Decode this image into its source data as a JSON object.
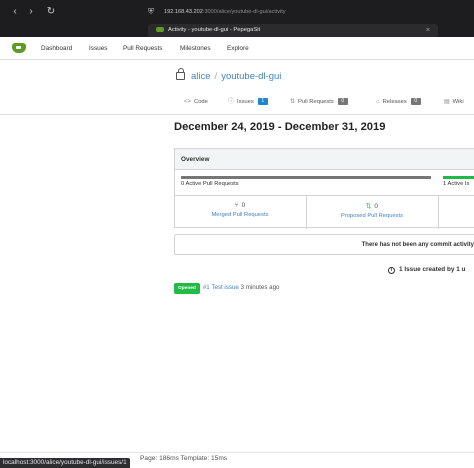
{
  "browser": {
    "url_host": "192.168.43.202",
    "url_path": ":3000/alice/youtube-dl-gui/activity",
    "tab_title": "Activity - youtube-dl-gui - PepegaSit",
    "back_icon": "‹",
    "forward_icon": "›",
    "reload_icon": "↻",
    "close_tab_icon": "×"
  },
  "nav": {
    "items": [
      "Dashboard",
      "Issues",
      "Pull Requests",
      "Milestones",
      "Explore"
    ]
  },
  "repo": {
    "owner": "alice",
    "separator": "/",
    "name": "youtube-dl-gui",
    "tabs": [
      {
        "label": "Code",
        "icon": "<>"
      },
      {
        "label": "Issues",
        "icon": "ⓘ",
        "count": "1"
      },
      {
        "label": "Pull Requests",
        "icon": "⇅",
        "count": "0"
      },
      {
        "label": "Releases",
        "icon": "⌂",
        "count": "0"
      },
      {
        "label": "Wiki",
        "icon": "▤"
      }
    ]
  },
  "activity": {
    "date_range": "December 24, 2019 - December 31, 2019",
    "overview_title": "Overview",
    "active_prs": "0 Active Pull Requests",
    "active_issues": "1 Active Is",
    "merged_count": "0",
    "merged_label": "Merged Pull Requests",
    "proposed_count": "0",
    "proposed_label": "Proposed Pull Requests",
    "no_commit_text": "There has not been any commit activity",
    "issues_created": "1 Issue created by 1 u",
    "issue": {
      "badge": "Opened",
      "number": "#1",
      "title": "Test issue",
      "time": "3 minutes ago"
    }
  },
  "footer": {
    "text": "Page: 186ms Template: 15ms",
    "status_url": "localhost:3000/alice/youtube-dl-gui/issues/1"
  },
  "colors": {
    "accent": "#609926",
    "link": "#4183c4",
    "green": "#21ba45"
  }
}
